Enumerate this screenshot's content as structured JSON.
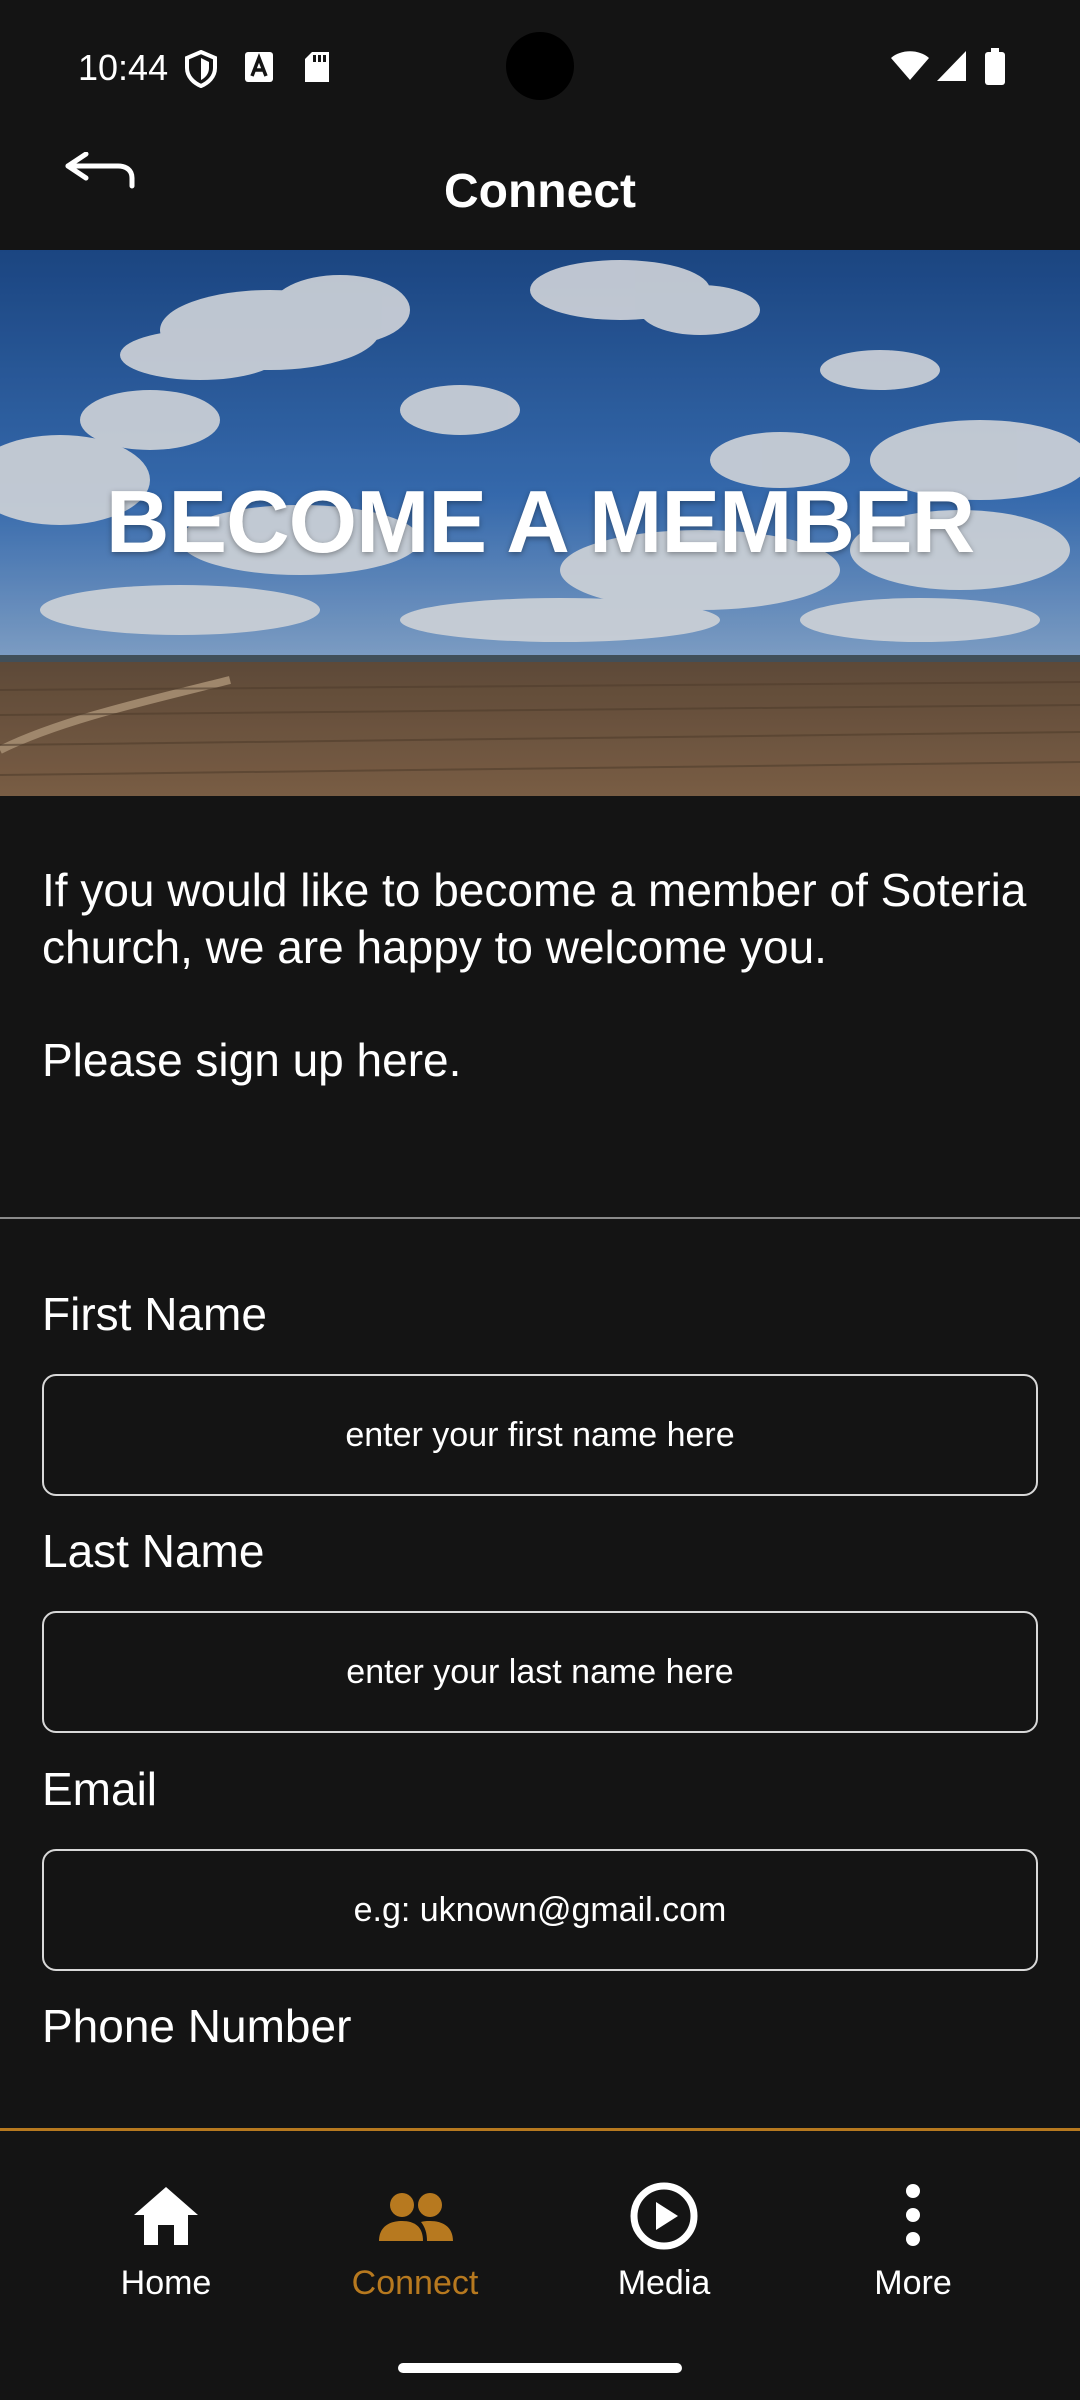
{
  "status_bar": {
    "time": "10:44",
    "left_icons": [
      "shield-icon",
      "keyboard-a-icon",
      "sd-card-icon"
    ],
    "right_icons": [
      "wifi-icon",
      "signal-icon",
      "battery-icon"
    ]
  },
  "header": {
    "title": "Connect",
    "back_icon": "back-arrow-icon"
  },
  "hero": {
    "title": "BECOME A MEMBER"
  },
  "intro": {
    "paragraph": "If you would like to become a member of Soteria church, we are happy to welcome you.",
    "signup_text": "Please sign up here."
  },
  "form": {
    "first_name": {
      "label": "First Name",
      "placeholder": "enter your first name here",
      "value": ""
    },
    "last_name": {
      "label": "Last Name",
      "placeholder": "enter your last name here",
      "value": ""
    },
    "email": {
      "label": "Email",
      "placeholder": "e.g: uknown@gmail.com",
      "value": ""
    },
    "phone": {
      "label": "Phone Number"
    }
  },
  "nav": {
    "items": [
      {
        "label": "Home",
        "icon": "home-icon",
        "active": false
      },
      {
        "label": "Connect",
        "icon": "people-icon",
        "active": true
      },
      {
        "label": "Media",
        "icon": "play-circle-icon",
        "active": false
      },
      {
        "label": "More",
        "icon": "more-vertical-icon",
        "active": false
      }
    ]
  },
  "colors": {
    "background": "#141414",
    "accent": "#b7791f",
    "text": "#ffffff"
  }
}
